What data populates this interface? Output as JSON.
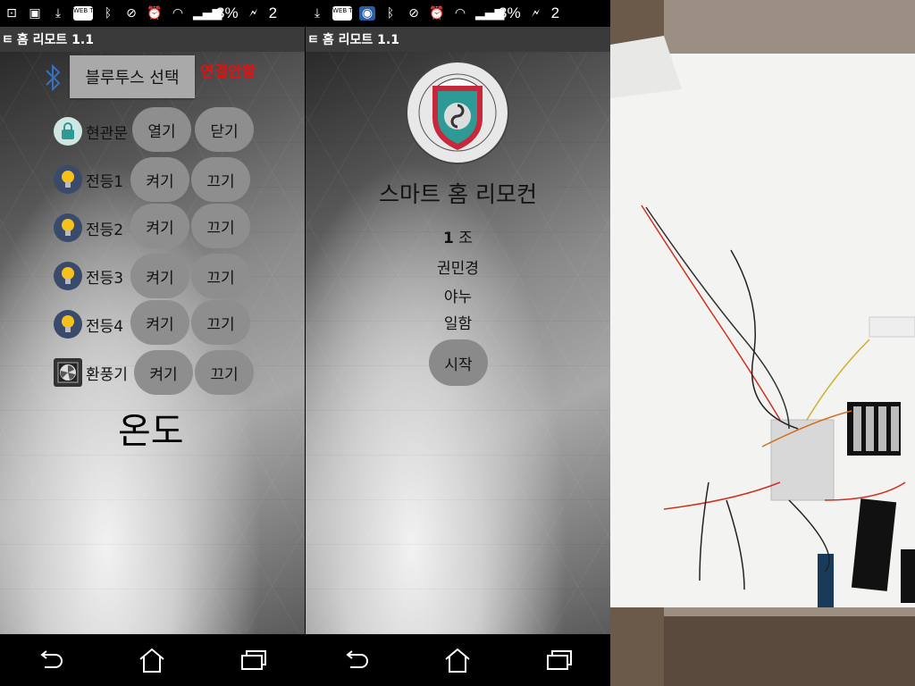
{
  "status_bar": {
    "battery": "3%",
    "time_partial": "2",
    "webtoon_label": "WEB TOON"
  },
  "app": {
    "title": "홈 리모트 1.1",
    "title_prefix_glyph": "ㅌ"
  },
  "bluetooth": {
    "select_label": "블루투스 선택",
    "status": "연결안함"
  },
  "devices": [
    {
      "name": "현관문",
      "icon": "lock-icon",
      "on_label": "열기",
      "off_label": "닫기"
    },
    {
      "name": "전등1",
      "icon": "bulb-icon",
      "on_label": "켜기",
      "off_label": "끄기"
    },
    {
      "name": "전등2",
      "icon": "bulb-icon",
      "on_label": "켜기",
      "off_label": "끄기"
    },
    {
      "name": "전등3",
      "icon": "bulb-icon",
      "on_label": "켜기",
      "off_label": "끄기"
    },
    {
      "name": "전등4",
      "icon": "bulb-icon",
      "on_label": "켜기",
      "off_label": "끄기"
    },
    {
      "name": "환풍기",
      "icon": "fan-icon",
      "on_label": "켜기",
      "off_label": "끄기"
    }
  ],
  "temperature_label": "온도",
  "intro": {
    "logo_text": "SUN MOON UNIVERSITY",
    "app_title": "스마트 홈 리모컨",
    "team_number": "1",
    "team_suffix": "조",
    "members": [
      "권민경",
      "야누",
      "일함"
    ],
    "start_label": "시작"
  },
  "colors": {
    "status_red": "#e31010",
    "button_gray": "#8e8e8e",
    "logo_teal": "#2e9a96",
    "logo_red": "#c8283c"
  }
}
